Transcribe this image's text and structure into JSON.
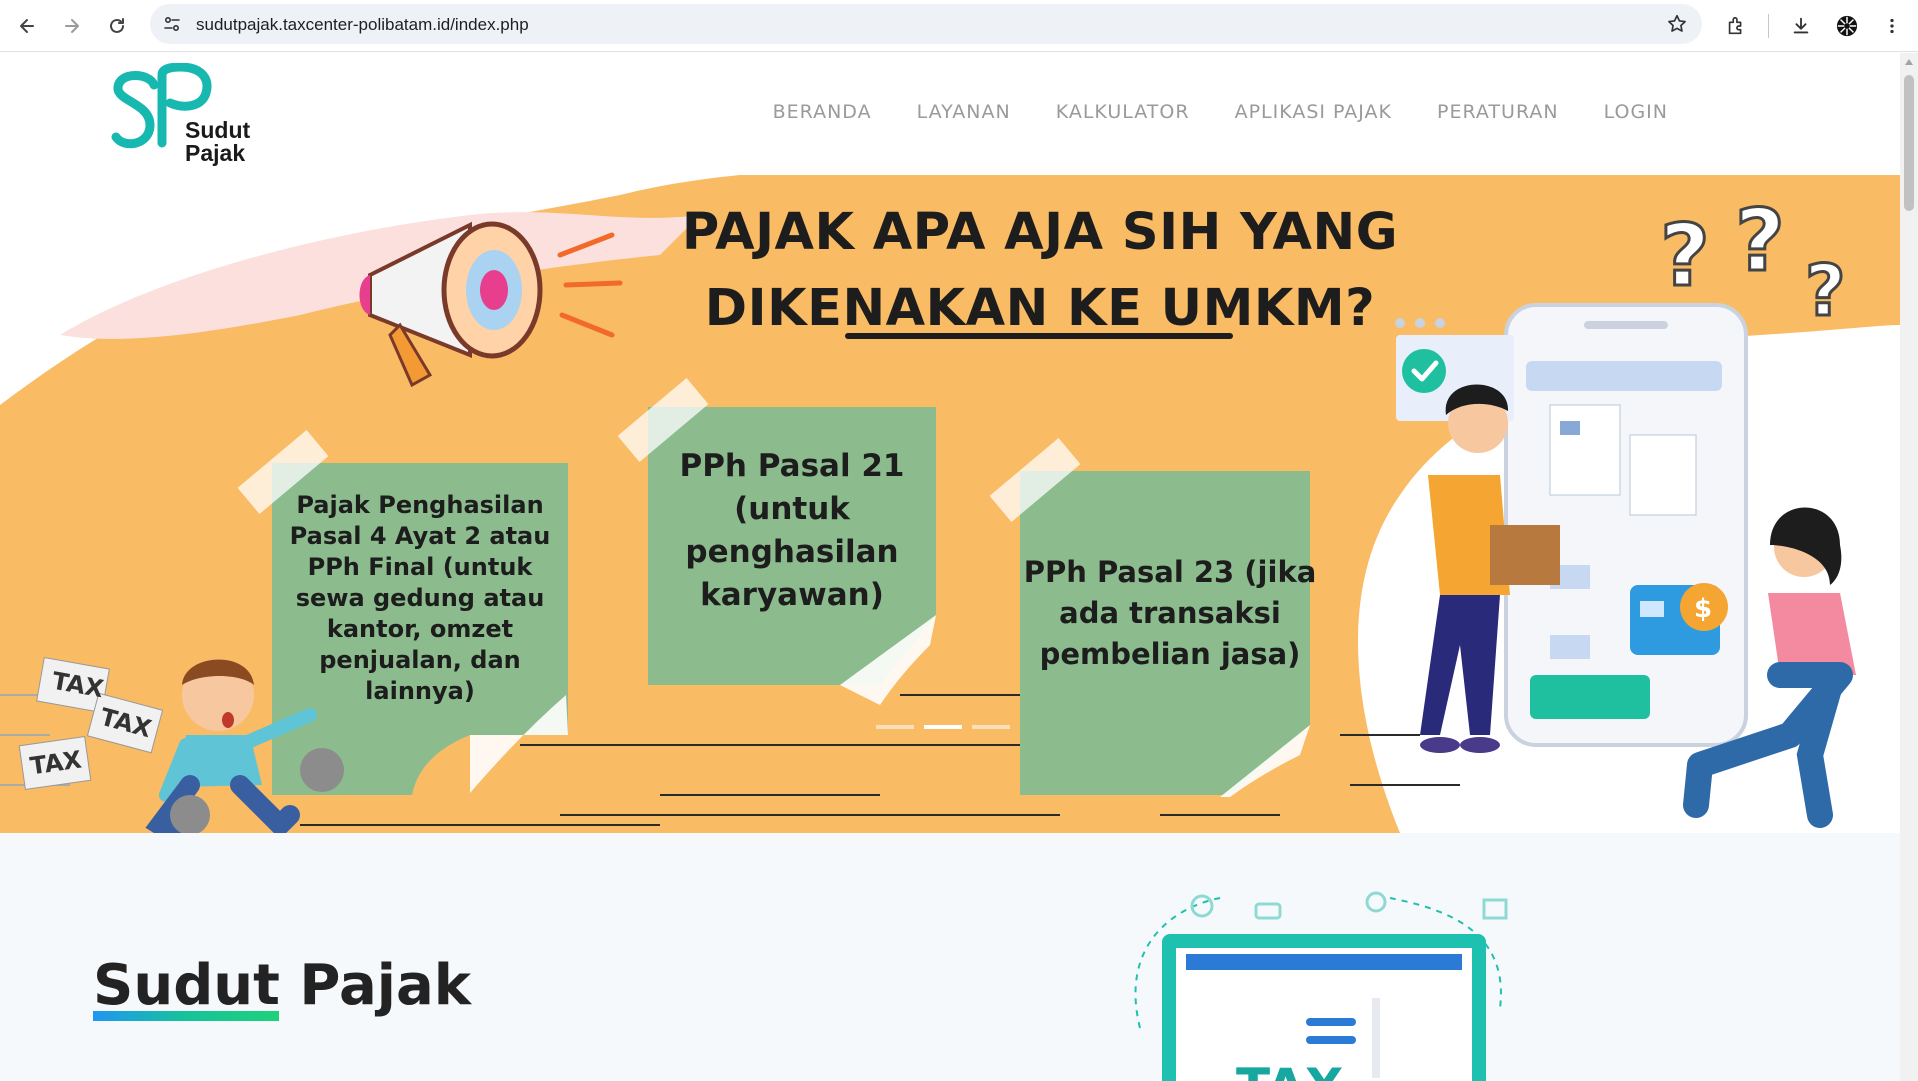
{
  "browser": {
    "url": "sudutpajak.taxcenter-polibatam.id/index.php",
    "icons": [
      "back-icon",
      "forward-icon",
      "reload-icon",
      "site-info-icon",
      "bookmark-star-icon",
      "extensions-icon",
      "download-icon",
      "profile-avatar-icon",
      "more-menu-icon"
    ]
  },
  "site": {
    "logo_mark": "SP",
    "logo_line1": "Sudut",
    "logo_line2": "Pajak",
    "nav": [
      {
        "label": "BERANDA"
      },
      {
        "label": "LAYANAN"
      },
      {
        "label": "KALKULATOR"
      },
      {
        "label": "APLIKASI PAJAK"
      },
      {
        "label": "PERATURAN"
      },
      {
        "label": "LOGIN"
      }
    ],
    "colors": {
      "brand_teal": "#17b8b0",
      "hero_orange": "#f9bb64",
      "note_green": "#8cbc8e"
    }
  },
  "hero": {
    "title_line1": "PAJAK APA AJA SIH YANG",
    "title_line2": "DIKENAKAN KE UMKM?",
    "notes": [
      "Pajak Penghasilan Pasal 4 Ayat 2 atau PPh Final (untuk sewa gedung atau kantor, omzet penjualan, dan lainnya)",
      "PPh Pasal 21 (untuk penghasilan karyawan)",
      "PPh Pasal 23 (jika ada transaksi pembelian jasa)"
    ],
    "tax_tags": [
      "TAX",
      "TAX",
      "TAX"
    ],
    "slide_count": 3,
    "active_slide": 2
  },
  "about": {
    "title": "Sudut Pajak",
    "illustration_text": "TAX"
  }
}
